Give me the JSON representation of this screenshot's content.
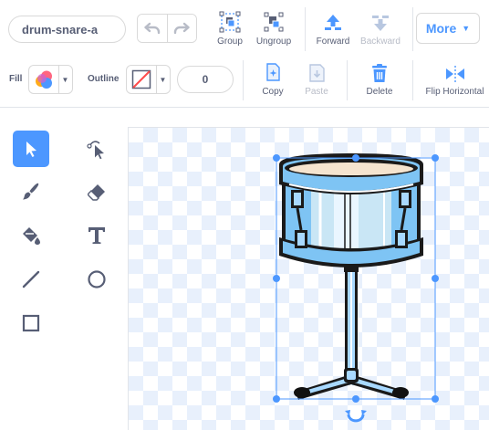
{
  "costume": {
    "name": "drum-snare-a"
  },
  "toolbar": {
    "undo_label": "Undo",
    "redo_label": "Redo",
    "group_label": "Group",
    "ungroup_label": "Ungroup",
    "forward_label": "Forward",
    "backward_label": "Backward",
    "more_label": "More",
    "fill_label": "Fill",
    "outline_label": "Outline",
    "outline_width": "0",
    "copy_label": "Copy",
    "paste_label": "Paste",
    "delete_label": "Delete",
    "flip_horizontal_label": "Flip Horizontal"
  },
  "tools": [
    {
      "name": "select",
      "icon": "arrow-pointer-icon",
      "active": true
    },
    {
      "name": "reshape",
      "icon": "reshape-icon",
      "active": false
    },
    {
      "name": "brush",
      "icon": "brush-icon",
      "active": false
    },
    {
      "name": "eraser",
      "icon": "eraser-icon",
      "active": false
    },
    {
      "name": "fill",
      "icon": "paint-bucket-icon",
      "active": false
    },
    {
      "name": "text",
      "icon": "text-T-icon",
      "active": false
    },
    {
      "name": "line",
      "icon": "line-icon",
      "active": false
    },
    {
      "name": "circle",
      "icon": "circle-icon",
      "active": false
    },
    {
      "name": "rectangle",
      "icon": "rectangle-icon",
      "active": false
    }
  ],
  "colors": {
    "accent": "#4c97ff",
    "text": "#575e75",
    "disabled": "#b8bcc7",
    "delete_icon": "#4c97ff",
    "copy_icon": "#4c97ff",
    "canvas_checker": "#e8f0fc"
  }
}
